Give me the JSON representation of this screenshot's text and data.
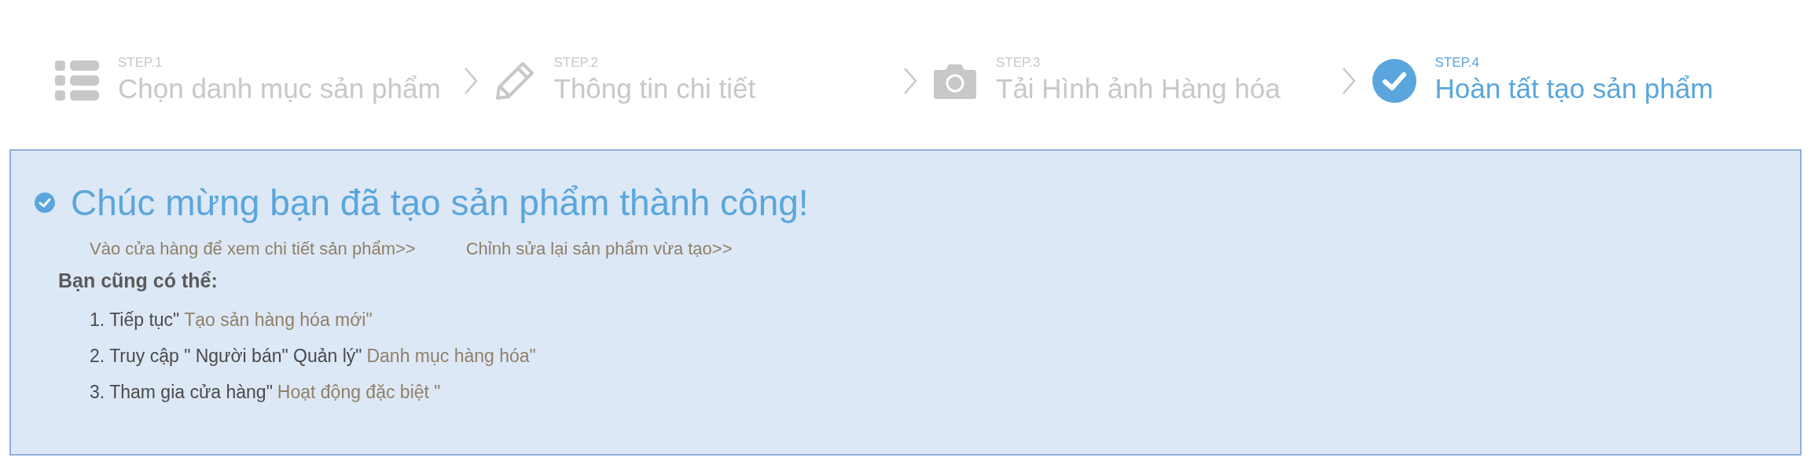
{
  "steps": [
    {
      "kind": "list",
      "step": "STEP.1",
      "label": "Chọn danh mục sản phẩm",
      "selected": false
    },
    {
      "kind": "pencil",
      "step": "STEP.2",
      "label": "Thông tin chi tiết",
      "selected": false
    },
    {
      "kind": "camera",
      "step": "STEP.3",
      "label": "Tải Hình ảnh Hàng hóa",
      "selected": false
    },
    {
      "kind": "check",
      "step": "STEP.4",
      "label": "Hoàn tất tạo sản phẩm",
      "selected": true
    }
  ],
  "panel": {
    "title": "Chúc mừng bạn đã tạo sản phẩm thành công!",
    "links": [
      "Vào cửa hàng để xem chi tiết sản phẩm>>",
      "Chỉnh sửa lại sản phẩm vừa tạo>>"
    ],
    "subtitle": "Bạn cũng có thể:",
    "items": [
      {
        "lead": "1. Tiếp tục\"",
        "link": "Tạo sản hàng hóa mới\""
      },
      {
        "lead": "2. Truy cập \" Người bán\" Quản lý\"",
        "link": "Danh mục hàng hóa\""
      },
      {
        "lead": "3. Tham gia cửa hàng\"",
        "link": "Hoạt động đặc biệt \""
      }
    ]
  }
}
